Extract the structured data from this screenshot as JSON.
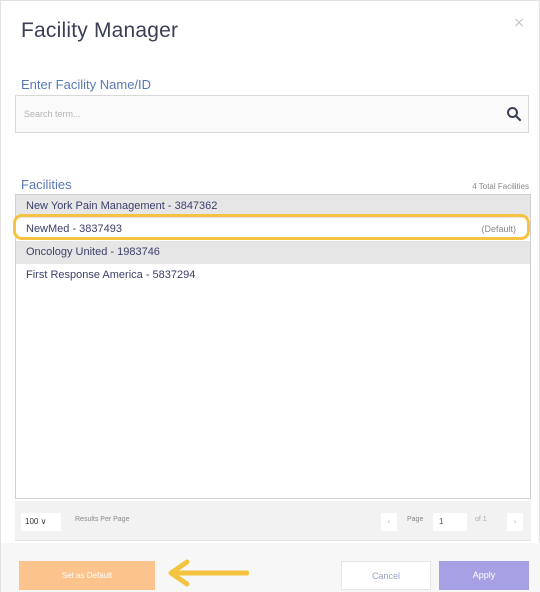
{
  "dialog": {
    "title": "Facility Manager",
    "close_glyph": "×"
  },
  "search": {
    "label": "Enter Facility Name/ID",
    "placeholder": "Search term...",
    "icon": "search-icon"
  },
  "facilities": {
    "label": "Facilities",
    "total": "4 Total Facilities",
    "items": [
      {
        "name": "New York Pain Management - 3847362",
        "badge": ""
      },
      {
        "name": "NewMed - 3837493",
        "badge": "(Default)"
      },
      {
        "name": "Oncology United - 1983746",
        "badge": ""
      },
      {
        "name": "First Response America - 5837294",
        "badge": ""
      }
    ]
  },
  "pager": {
    "per_page": "100 ∨",
    "per_page_label": "Results Per Page",
    "prev": "‹",
    "page_label": "Page",
    "page": "1",
    "of_total": "of 1",
    "next": "›"
  },
  "footer": {
    "set_default": "Set as Default",
    "cancel": "Cancel",
    "apply": "Apply"
  },
  "colors": {
    "highlight": "#f4c340",
    "accent": "#a6a0e4",
    "default_button": "#fcc38c",
    "label_blue": "#5a77b8"
  }
}
